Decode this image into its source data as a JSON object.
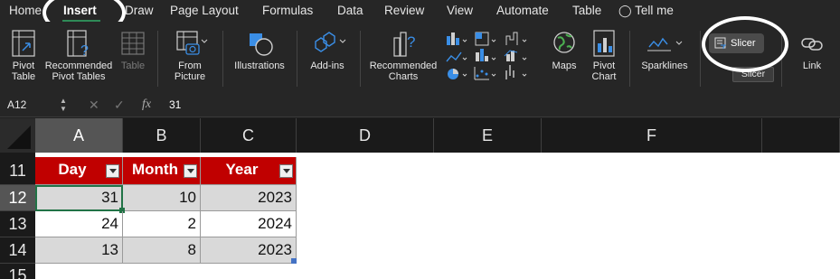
{
  "menu": {
    "tabs": [
      "Home",
      "Insert",
      "Draw",
      "Page Layout",
      "Formulas",
      "Data",
      "Review",
      "View",
      "Automate",
      "Table"
    ],
    "active_tab": "Insert",
    "tell_me": "Tell me"
  },
  "ribbon": {
    "pivot_table": "Pivot Table",
    "recommended_pivot_tables": "Recommended Pivot Tables",
    "table": "Table",
    "from_picture": "From Picture",
    "illustrations": "Illustrations",
    "add_ins": "Add-ins",
    "recommended_charts": "Recommended Charts",
    "maps": "Maps",
    "pivot_chart": "Pivot Chart",
    "sparklines": "Sparklines",
    "slicer": "Slicer",
    "slicer_tooltip": "Slicer",
    "link": "Link"
  },
  "formula_bar": {
    "name_box": "A12",
    "fx": "fx",
    "content": "31"
  },
  "grid": {
    "columns": [
      "A",
      "B",
      "C",
      "D",
      "E",
      "F"
    ],
    "rows": [
      "11",
      "12",
      "13",
      "14",
      "15"
    ],
    "table": {
      "headers": [
        "Day",
        "Month",
        "Year"
      ],
      "rows": [
        [
          "31",
          "10",
          "2023"
        ],
        [
          "24",
          "2",
          "2024"
        ],
        [
          "13",
          "8",
          "2023"
        ]
      ]
    }
  },
  "colors": {
    "table_header": "#c00000",
    "band": "#d9d9d9",
    "selection": "#217346"
  }
}
